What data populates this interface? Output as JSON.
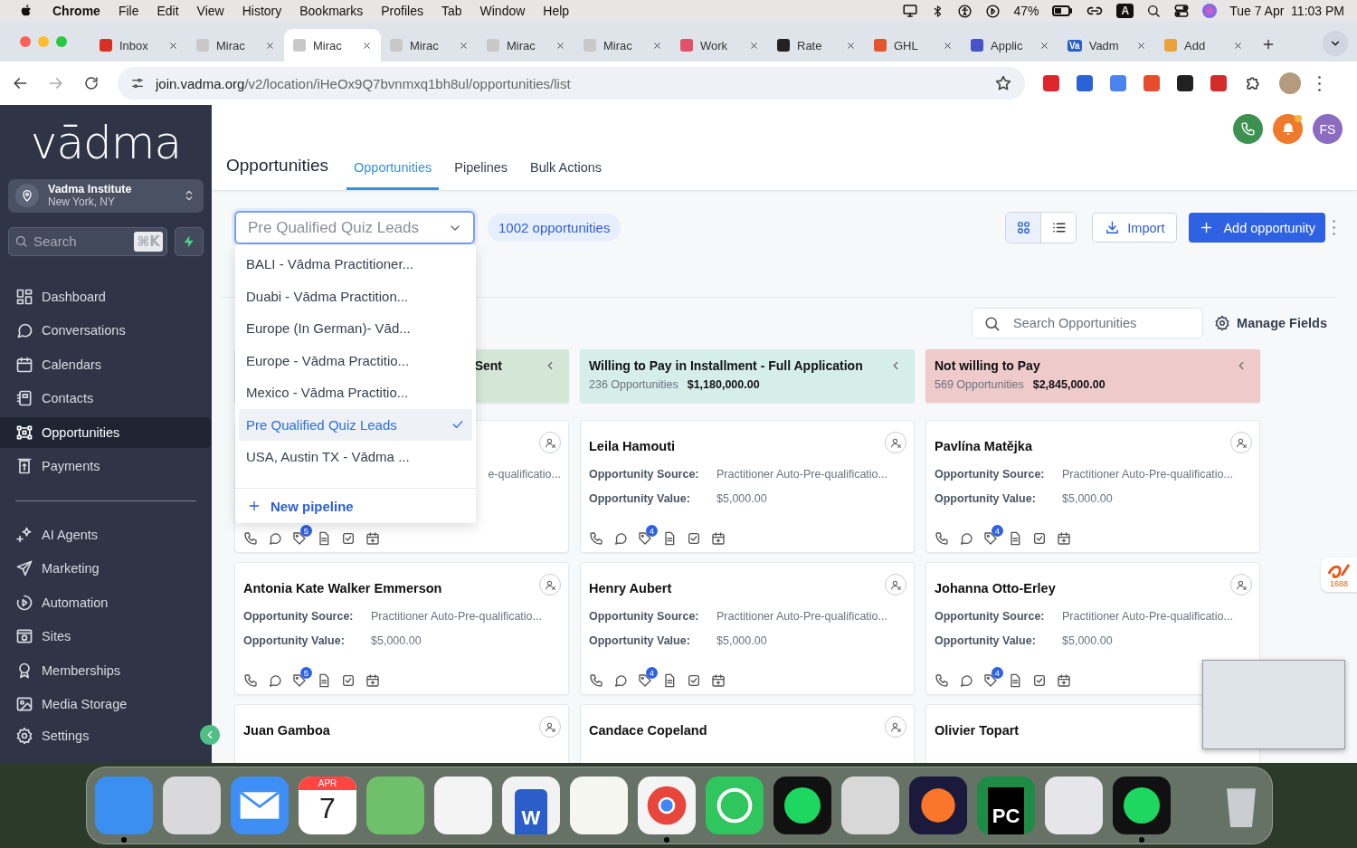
{
  "menubar": {
    "app": "Chrome",
    "menus": [
      "File",
      "Edit",
      "View",
      "History",
      "Bookmarks",
      "Profiles",
      "Tab",
      "Window",
      "Help"
    ],
    "battery": "47%",
    "input_source": "A",
    "clock": "Tue 7 Apr  11:03 PM"
  },
  "browser": {
    "tabs": [
      {
        "title": "Inbox",
        "selected": false
      },
      {
        "title": "Mirac",
        "selected": false
      },
      {
        "title": "Mirac",
        "selected": true
      },
      {
        "title": "Mirac",
        "selected": false
      },
      {
        "title": "Mirac",
        "selected": false
      },
      {
        "title": "Mirac",
        "selected": false
      },
      {
        "title": "Work",
        "selected": false
      },
      {
        "title": "Rate",
        "selected": false
      },
      {
        "title": "GHL",
        "selected": false
      },
      {
        "title": "Applic",
        "selected": false
      },
      {
        "title": "Vadm",
        "favicon_text": "Va",
        "selected": false
      },
      {
        "title": "Add",
        "selected": false
      }
    ],
    "url_host": "join.vadma.org",
    "url_path": "/v2/location/iHeOx9Q7bvnmxq1bh8ul/opportunities/list"
  },
  "sidebar": {
    "logo": "vādma",
    "account": {
      "name": "Vadma Institute",
      "location": "New York, NY"
    },
    "search": {
      "placeholder": "Search",
      "shortcut": "⌘K"
    },
    "nav": [
      {
        "label": "Dashboard",
        "selected": false
      },
      {
        "label": "Conversations",
        "selected": false
      },
      {
        "label": "Calendars",
        "selected": false
      },
      {
        "label": "Contacts",
        "selected": false
      },
      {
        "label": "Opportunities",
        "selected": true
      },
      {
        "label": "Payments",
        "selected": false
      }
    ],
    "nav_secondary": [
      {
        "label": "AI Agents",
        "selected": false
      },
      {
        "label": "Marketing",
        "selected": false
      },
      {
        "label": "Automation",
        "selected": false
      },
      {
        "label": "Sites",
        "selected": false
      },
      {
        "label": "Memberships",
        "selected": false
      },
      {
        "label": "Media Storage",
        "selected": false
      }
    ],
    "footer_nav": [
      {
        "label": "Settings",
        "selected": false
      }
    ]
  },
  "header": {
    "title": "Opportunities",
    "tabs": [
      {
        "label": "Opportunities",
        "selected": true
      },
      {
        "label": "Pipelines",
        "selected": false
      },
      {
        "label": "Bulk Actions",
        "selected": false
      }
    ],
    "avatar": "FS"
  },
  "toolbar": {
    "pipeline_select": {
      "placeholder": "Pre Qualified Quiz Leads",
      "open": true
    },
    "count_badge": "1002 opportunities",
    "view_toggle": [
      {
        "selected": true
      },
      {
        "selected": false
      }
    ],
    "import": "Import",
    "add": "Add opportunity"
  },
  "pipeline_menu": {
    "options": [
      {
        "label": "BALI - Vādma Practitioner...",
        "selected": false
      },
      {
        "label": "Duabi - Vādma Practition...",
        "selected": false
      },
      {
        "label": "Europe (In German)- Vād...",
        "selected": false
      },
      {
        "label": "Europe - Vādma Practitio...",
        "selected": false
      },
      {
        "label": "Mexico - Vādma Practitio...",
        "selected": false
      },
      {
        "label": "Pre Qualified Quiz Leads",
        "selected": true
      },
      {
        "label": "USA, Austin TX - Vādma ...",
        "selected": false
      }
    ],
    "new": "New pipeline"
  },
  "board": {
    "search": {
      "placeholder": "Search Opportunities"
    },
    "manage_fields": "Manage Fields",
    "columns": [
      {
        "title": "Sent",
        "color": "#d4e7d7",
        "cards": [
          {
            "source_value": "e-qualificatio...",
            "badge": "5"
          },
          {
            "name": "Antonia Kate Walker Emmerson",
            "source_label": "Opportunity Source:",
            "source_value": "Practitioner Auto-Pre-qualificatio...",
            "value_label": "Opportunity Value:",
            "value": "$5,000.00",
            "badge": "5"
          },
          {
            "name": "Juan Gamboa"
          }
        ]
      },
      {
        "title": "Willing to Pay in Installment - Full Application",
        "count": "236 Opportunities",
        "total": "$1,180,000.00",
        "color": "#d5eeea",
        "cards": [
          {
            "name": "Leila Hamouti",
            "source_label": "Opportunity Source:",
            "source_value": "Practitioner Auto-Pre-qualificatio...",
            "value_label": "Opportunity Value:",
            "value": "$5,000.00",
            "badge": "4"
          },
          {
            "name": "Henry Aubert",
            "source_label": "Opportunity Source:",
            "source_value": "Practitioner Auto-Pre-qualificatio...",
            "value_label": "Opportunity Value:",
            "value": "$5,000.00",
            "badge": "4"
          },
          {
            "name": "Candace Copeland"
          }
        ]
      },
      {
        "title": "Not willing to Pay",
        "count": "569 Opportunities",
        "total": "$2,845,000.00",
        "color": "#eecaca",
        "cards": [
          {
            "name": "Pavlína Matějka",
            "source_label": "Opportunity Source:",
            "source_value": "Practitioner Auto-Pre-qualificatio...",
            "value_label": "Opportunity Value:",
            "value": "$5,000.00",
            "badge": "4"
          },
          {
            "name": "Johanna Otto-Erley",
            "source_label": "Opportunity Source:",
            "source_value": "Practitioner Auto-Pre-qualificatio...",
            "value_label": "Opportunity Value:",
            "value": "$5,000.00",
            "badge": "4"
          },
          {
            "name": "Olivier Topart"
          }
        ]
      }
    ]
  },
  "side_widget": {
    "label": "1688"
  },
  "dock": [
    {
      "running": true
    },
    {
      "running": false
    },
    {
      "running": false
    },
    {
      "running": false,
      "month": "APR",
      "day": "7"
    },
    {
      "running": false
    },
    {
      "running": false
    },
    {
      "running": false,
      "label": "W"
    },
    {
      "running": false
    },
    {
      "running": true
    },
    {
      "running": false
    },
    {
      "running": false
    },
    {
      "running": false
    },
    {
      "running": false
    },
    {
      "running": false,
      "label": "PC"
    },
    {
      "running": false
    },
    {
      "running": true
    },
    {
      "running": false
    }
  ]
}
